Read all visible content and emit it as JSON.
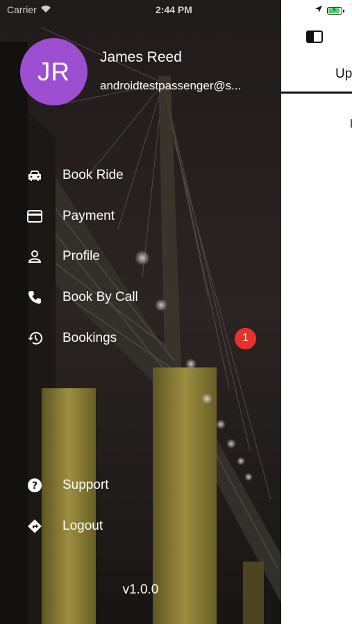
{
  "status_bar": {
    "carrier": "Carrier",
    "time": "2:44 PM"
  },
  "app": {
    "tab_label": "Up"
  },
  "user": {
    "initials": "JR",
    "name": "James Reed",
    "email": "androidtestpassenger@s..."
  },
  "menu": {
    "book_ride": "Book Ride",
    "payment": "Payment",
    "profile": "Profile",
    "book_by_call": "Book By Call",
    "bookings": "Bookings",
    "bookings_badge": "1",
    "support": "Support",
    "logout": "Logout"
  },
  "version": "v1.0.0",
  "colors": {
    "avatar": "#9b4fd0",
    "badge": "#e8302c",
    "battery": "#4cd964"
  },
  "battery_level": 0.8
}
